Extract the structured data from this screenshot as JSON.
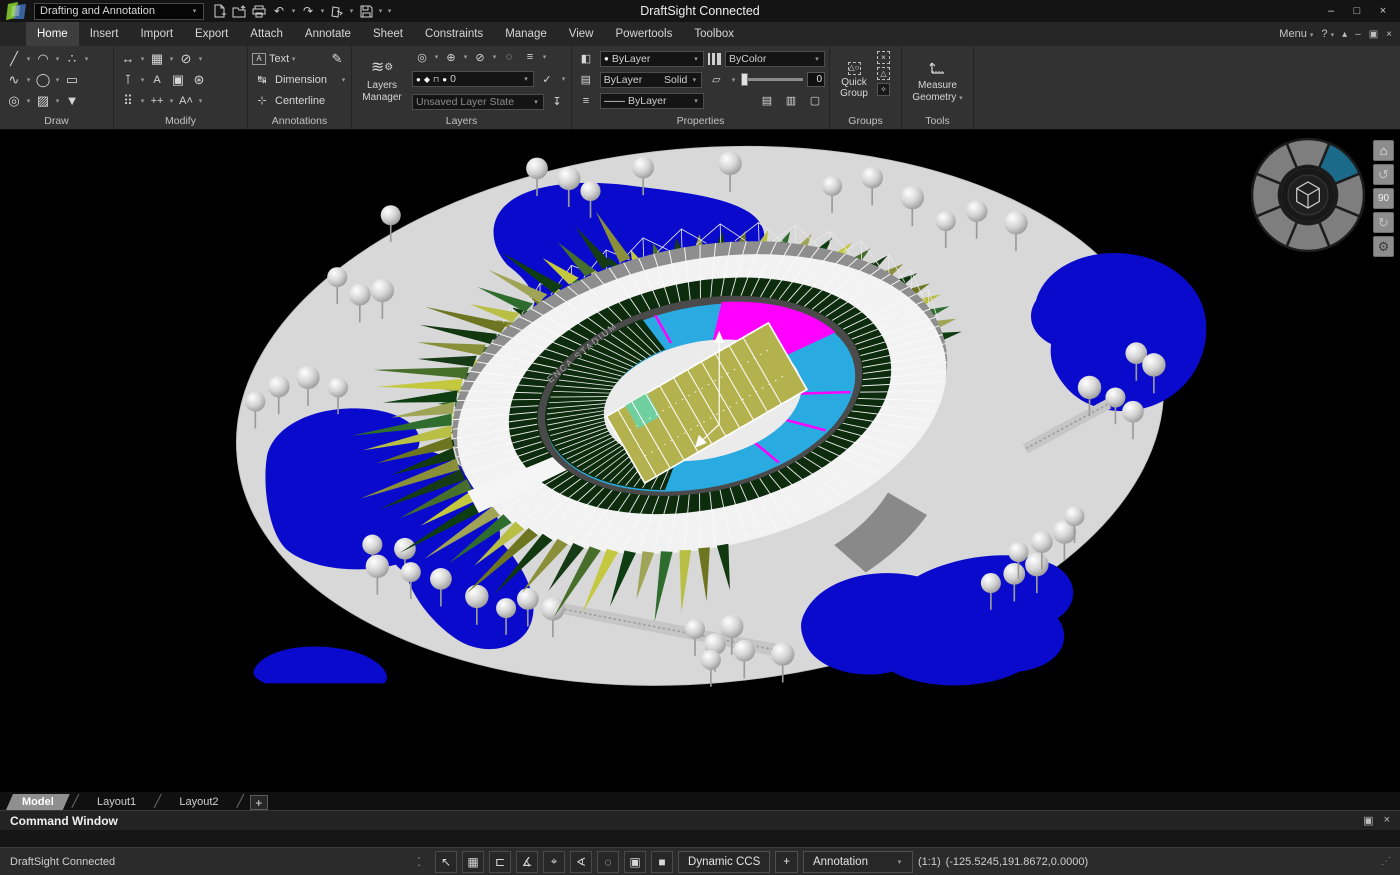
{
  "titlebar": {
    "workspace": "Drafting and Annotation",
    "title": "DraftSight Connected",
    "minimize": "–",
    "maximize": "□",
    "close": "×"
  },
  "icons": {
    "dropdown_caret": "▾",
    "undo": "↶",
    "redo": "↷",
    "home": "⌂",
    "rotate_ccw": "↺",
    "rotate_cw": "↻",
    "gear": "⚙",
    "check": "✓",
    "pen": "✎",
    "restore": "▣",
    "close": "×",
    "collapse": "▴",
    "minimize": "–",
    "help": "?"
  },
  "tabs": [
    "Home",
    "Insert",
    "Import",
    "Export",
    "Attach",
    "Annotate",
    "Sheet",
    "Constraints",
    "Manage",
    "View",
    "Powertools",
    "Toolbox"
  ],
  "ribbon_right": {
    "menu": "Menu",
    "help": "?"
  },
  "panels": {
    "draw": {
      "label": "Draw"
    },
    "modify": {
      "label": "Modify"
    },
    "annotations": {
      "label": "Annotations",
      "text": "Text",
      "dimension": "Dimension",
      "centerline": "Centerline"
    },
    "layers": {
      "label": "Layers",
      "manager": "Layers Manager",
      "active_layer": "0",
      "layer_state": "Unsaved Layer State"
    },
    "properties": {
      "label": "Properties",
      "line_color": "ByLayer",
      "hatch_pattern": "ByLayer",
      "hatch_fill": "Solid",
      "line_style": "ByLayer",
      "line_weight": "ByColor",
      "transparency_value": "0"
    },
    "groups": {
      "label": "Groups",
      "quick_group": "Quick Group"
    },
    "tools": {
      "label": "Tools",
      "measure": "Measure Geometry"
    }
  },
  "viewport": {
    "stadium_label": "ENCA STADIUM",
    "nav_90": "90"
  },
  "sheet_tabs": {
    "model": "Model",
    "layout1": "Layout1",
    "layout2": "Layout2",
    "add": "+"
  },
  "command": {
    "title": "Command Window"
  },
  "statusbar": {
    "left": "DraftSight Connected",
    "icons": [
      "⁚",
      "↖",
      "▦",
      "⊏",
      "∡",
      "⌖",
      "∢",
      "◌",
      "▣",
      "■"
    ],
    "dynamic_ccs": "Dynamic CCS",
    "plus": "+",
    "annotation": "Annotation",
    "scale": "(1:1)",
    "coords": "(-125.5245,191.8672,0.0000)",
    "grip": "⋰"
  },
  "colors": {
    "pond": "#0a0acd",
    "ground": "#d8d8d8",
    "seats_cyan": "#29abe2",
    "seats_magenta": "#ff00ff",
    "bowl_green": "#0d2b0d",
    "field": "#b4b24e",
    "field_patch": "#6fcf9f",
    "wheel_highlight": "#1b6a8a"
  }
}
